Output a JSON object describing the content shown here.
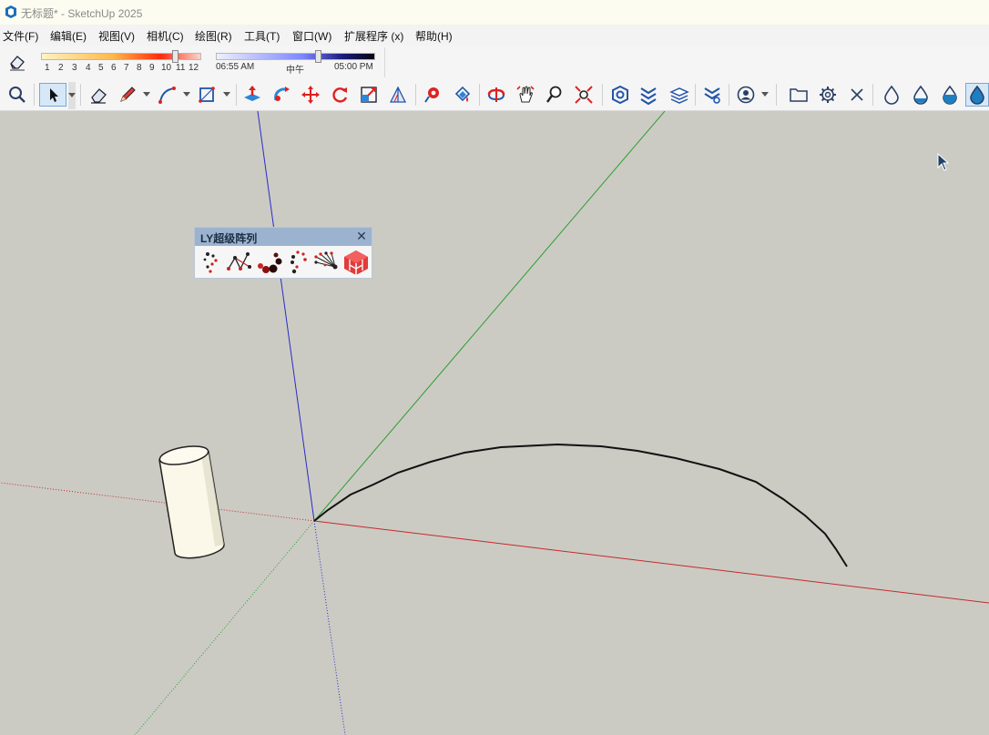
{
  "window": {
    "title": "无标题* - SketchUp 2025"
  },
  "menu": [
    "文件(F)",
    "编辑(E)",
    "视图(V)",
    "相机(C)",
    "绘图(R)",
    "工具(T)",
    "窗口(W)",
    "扩展程序 (x)",
    "帮助(H)"
  ],
  "shadows": {
    "months": [
      "1",
      "2",
      "3",
      "4",
      "5",
      "6",
      "7",
      "8",
      "9",
      "10",
      "11",
      "12"
    ],
    "month_value": 11,
    "time_start": "06:55 AM",
    "time_noon": "中午",
    "time_end": "05:00 PM",
    "time_value_fraction": 0.71
  },
  "toolbar": {
    "selected_tool": "select-tool",
    "icons": [
      "zoom-icon",
      "select-arrow-icon",
      "eraser-icon",
      "pencil-icon",
      "arc-icon",
      "rectangle-icon",
      "push-pull-icon",
      "follow-me-icon",
      "move-icon",
      "rotate-icon",
      "scale-icon",
      "section-plane-icon",
      "tape-measure-icon",
      "paint-bucket-icon",
      "orbit-icon",
      "pan-icon",
      "zoom-window-icon",
      "zoom-extents-icon",
      "component-icon",
      "solid-tools-icon",
      "layers-icon",
      "model-settings-icon",
      "user-icon",
      "folder-icon",
      "gear-icon",
      "close-icon",
      "drop-outline-icon",
      "drop-third-icon",
      "drop-half-icon",
      "drop-full-icon"
    ]
  },
  "palette": {
    "title": "LY超级阵列",
    "buttons": [
      "path-array-icon",
      "point-array-icon",
      "curve-array-icon",
      "arc-array-icon",
      "radial-array-icon",
      "array-3d-icon"
    ]
  },
  "colors": {
    "x_axis": "#c8282a",
    "y_axis": "#2e9d2e",
    "z_axis": "#2a2ac8",
    "background": "#cbcbc4",
    "palette_title": "#9cb3cf"
  }
}
